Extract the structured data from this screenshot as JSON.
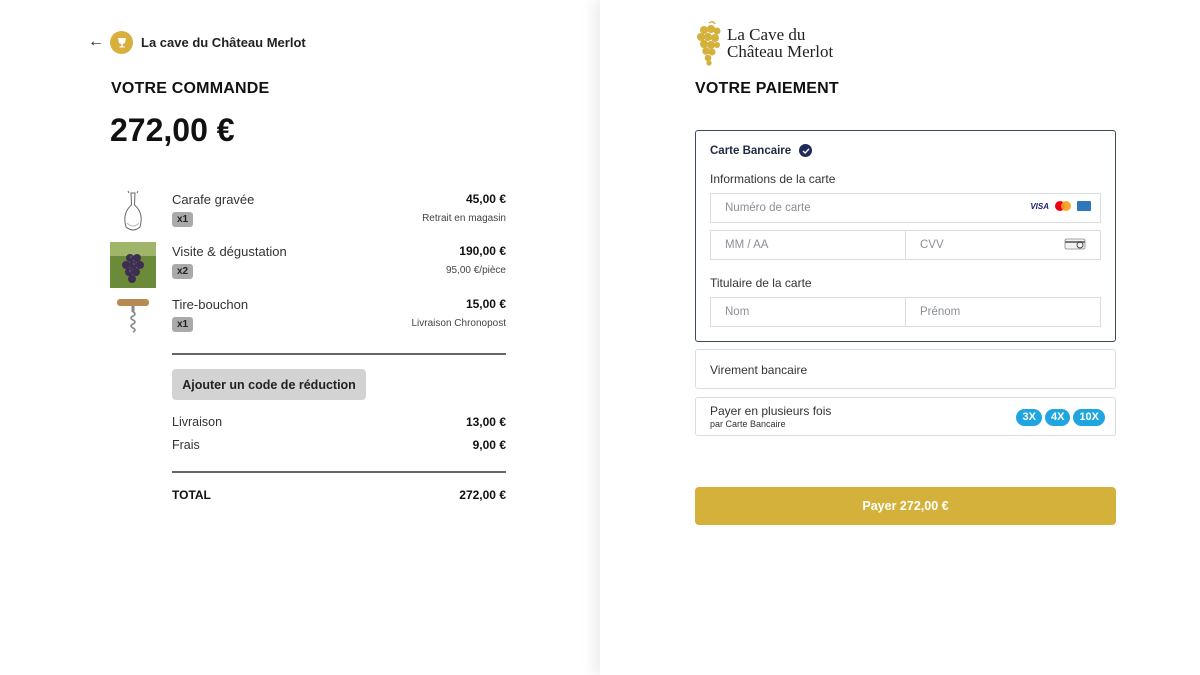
{
  "header": {
    "back_icon": "arrow-left",
    "shop_name": "La cave du Château Merlot"
  },
  "order": {
    "title": "VOTRE COMMANDE",
    "total": "272,00 €",
    "items": [
      {
        "name": "Carafe gravée",
        "qty": "x1",
        "price": "45,00 €",
        "sub": "Retrait en magasin",
        "icon": "carafe"
      },
      {
        "name": "Visite & dégustation",
        "qty": "x2",
        "price": "190,00 €",
        "sub": "95,00 €/pièce",
        "icon": "grapes-photo"
      },
      {
        "name": "Tire-bouchon",
        "qty": "x1",
        "price": "15,00 €",
        "sub": "Livraison Chronopost",
        "icon": "corkscrew"
      }
    ],
    "promo_button": "Ajouter un code de réduction",
    "summary": [
      {
        "label": "Livraison",
        "value": "13,00 €"
      },
      {
        "label": "Frais",
        "value": "9,00 €"
      }
    ],
    "total_label": "TOTAL",
    "total_value": "272,00 €"
  },
  "payment": {
    "brand_line1": "La Cave du",
    "brand_line2": "Château Merlot",
    "title": "VOTRE PAIEMENT",
    "card": {
      "label": "Carte Bancaire",
      "info_label": "Informations de la carte",
      "number_placeholder": "Numéro de carte",
      "expiry_placeholder": "MM / AA",
      "cvv_placeholder": "CVV",
      "holder_label": "Titulaire de la carte",
      "lastname_placeholder": "Nom",
      "firstname_placeholder": "Prénom",
      "visa_text": "VISA"
    },
    "transfer_label": "Virement bancaire",
    "installments_label": "Payer en plusieurs fois",
    "installments_sub": "par Carte Bancaire",
    "installment_badges": [
      "3X",
      "4X",
      "10X"
    ],
    "pay_button": "Payer 272,00 €"
  },
  "colors": {
    "gold": "#d4b13b",
    "navy": "#1f2a5c",
    "badge_blue": "#1fa6e0"
  }
}
